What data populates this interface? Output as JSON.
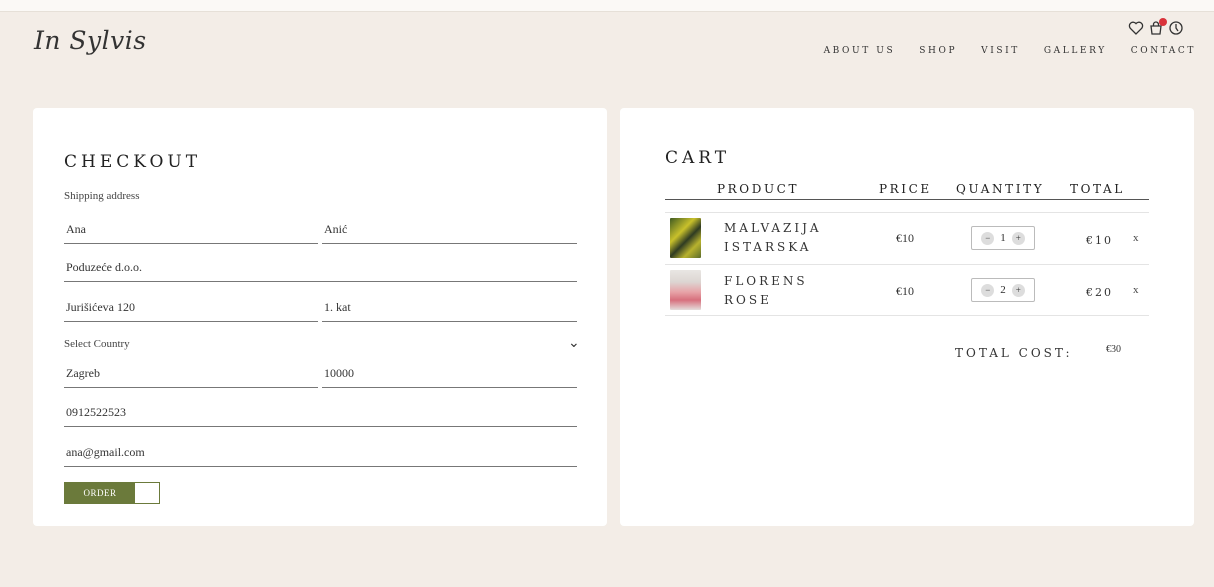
{
  "brand": {
    "logo_text": "In Sylvis"
  },
  "header_icons": [
    "heart-icon",
    "cart-icon",
    "account-icon"
  ],
  "nav": {
    "items": [
      "ABOUT US",
      "SHOP",
      "VISIT",
      "GALLERY",
      "CONTACT"
    ]
  },
  "checkout": {
    "title": "CHECKOUT",
    "shipping_label": "Shipping address",
    "fields": {
      "first_name": "Ana",
      "last_name": "Anić",
      "company": "Poduzeće d.o.o.",
      "street": "Jurišićeva 120",
      "apartment": "1. kat",
      "country": "Select Country",
      "city": "Zagreb",
      "postal": "10000",
      "phone": "0912522523",
      "email": "ana@gmail.com"
    },
    "order_label": "ORDER"
  },
  "cart": {
    "title": "CART",
    "columns": [
      "PRODUCT",
      "PRICE",
      "QUANTITY",
      "TOTAL"
    ],
    "items": [
      {
        "name_line1": "MALVAZIJA",
        "name_line2": "ISTARSKA",
        "price": "€10",
        "qty": "1",
        "total": "€10",
        "remove": "x"
      },
      {
        "name_line1": "FLORENS",
        "name_line2": "ROSE",
        "price": "€10",
        "qty": "2",
        "total": "€20",
        "remove": "x"
      }
    ],
    "total_label": "TOTAL COST:",
    "total_value": "€30"
  },
  "colors": {
    "accent": "#6b7a3b",
    "background": "#f3ede7",
    "badge": "#d9323a"
  }
}
